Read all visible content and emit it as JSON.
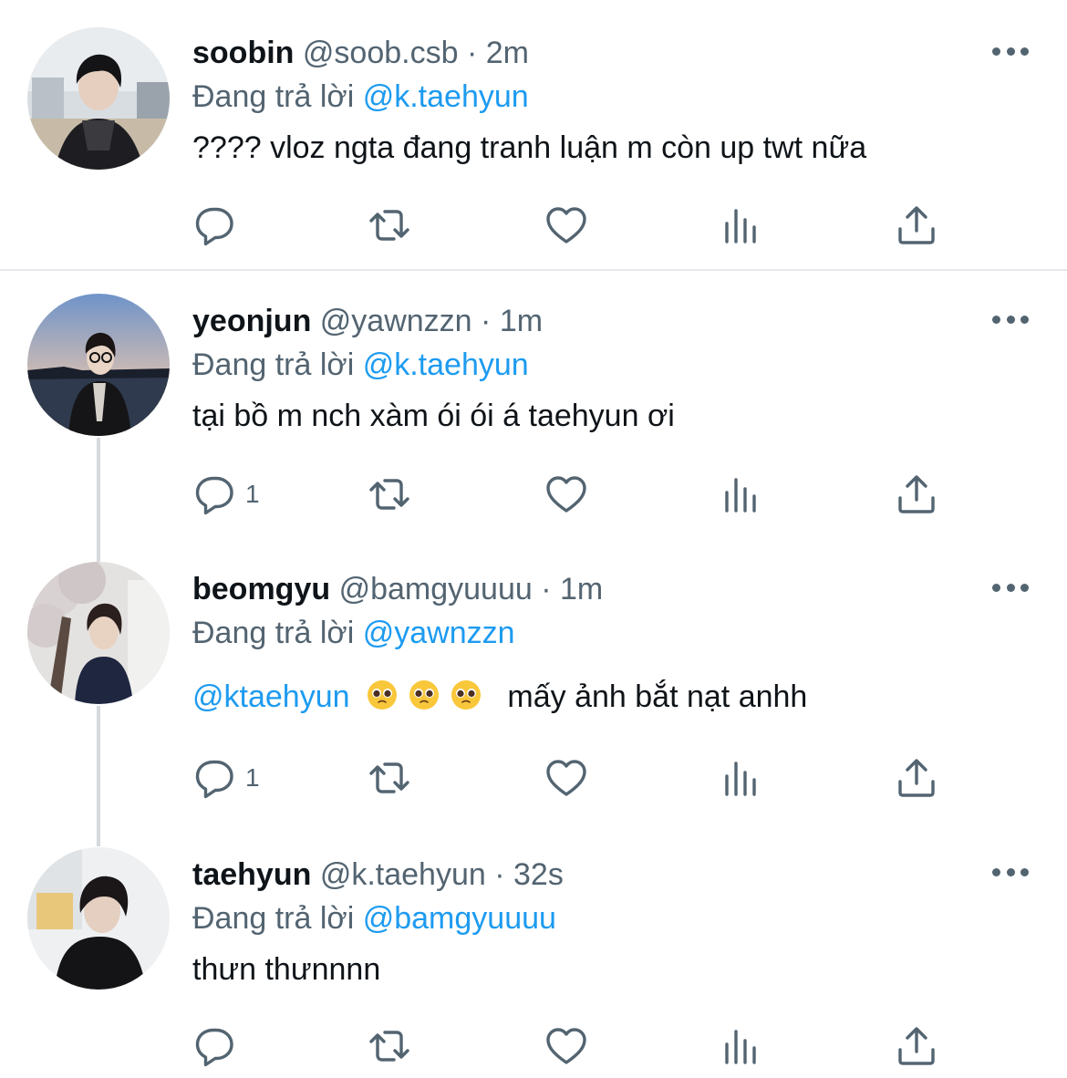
{
  "tweets": [
    {
      "name": "soobin",
      "handle": "@soob.csb",
      "dot": "·",
      "time": "2m",
      "reply_prefix": "Đang trả lời",
      "reply_to": "@k.taehyun",
      "text": "???? vloz ngta đang tranh luận m còn up twt nữa",
      "reply_count": ""
    },
    {
      "name": "yeonjun",
      "handle": "@yawnzzn",
      "dot": "·",
      "time": "1m",
      "reply_prefix": "Đang trả lời",
      "reply_to": "@k.taehyun",
      "text": "tại bồ m nch xàm ói ói á taehyun ơi",
      "reply_count": "1"
    },
    {
      "name": "beomgyu",
      "handle": "@bamgyuuuu",
      "dot": "·",
      "time": "1m",
      "reply_prefix": "Đang trả lời",
      "reply_to": "@yawnzzn",
      "text_mention": "@ktaehyun",
      "text": "mấy ảnh bắt nạt anhh",
      "emojis": [
        "pleading-face",
        "pleading-face",
        "pleading-face"
      ],
      "reply_count": "1"
    },
    {
      "name": "taehyun",
      "handle": "@k.taehyun",
      "dot": "·",
      "time": "32s",
      "reply_prefix": "Đang trả lời",
      "reply_to": "@bamgyuuuu",
      "text": "thưn thưnnnn",
      "reply_count": ""
    }
  ],
  "icons": [
    "reply-icon",
    "retweet-icon",
    "like-icon",
    "analytics-icon",
    "share-icon",
    "more-icon"
  ],
  "colors": {
    "mention": "#1d9bf0",
    "secondary": "#536471",
    "text": "#0f1419",
    "thread_line": "#d4d9dd",
    "separator": "#e6e9ec"
  }
}
